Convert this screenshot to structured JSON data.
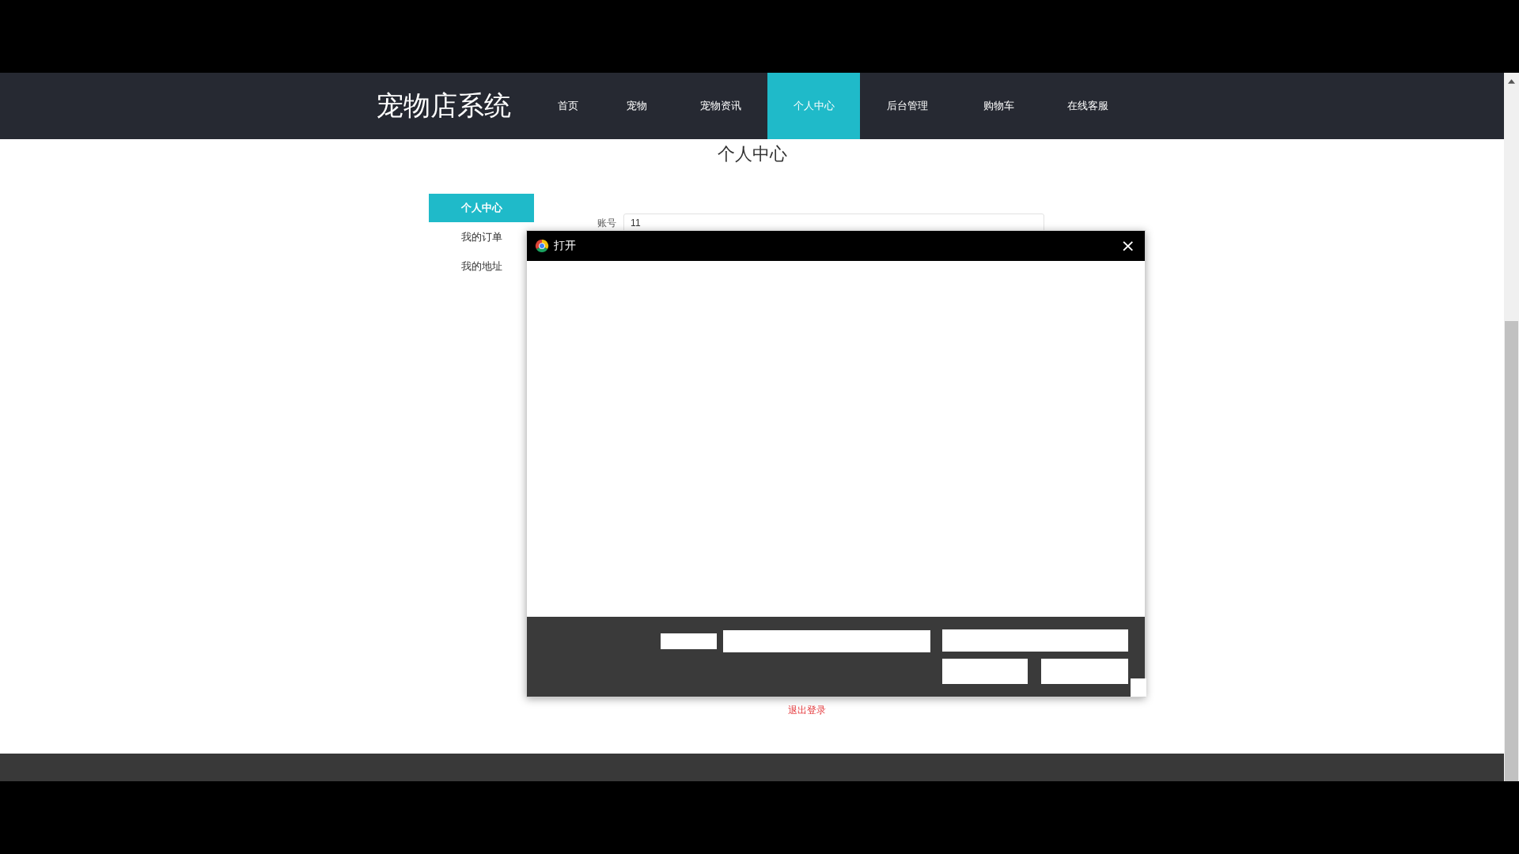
{
  "nav": {
    "logo": "宠物店系统",
    "items": [
      {
        "label": "首页",
        "selected": false
      },
      {
        "label": "宠物",
        "selected": false
      },
      {
        "label": "宠物资讯",
        "selected": false
      },
      {
        "label": "个人中心",
        "selected": true
      },
      {
        "label": "后台管理",
        "selected": false
      },
      {
        "label": "购物车",
        "selected": false
      },
      {
        "label": "在线客服",
        "selected": false
      }
    ]
  },
  "page_title": "个人中心",
  "sidebar": {
    "items": [
      {
        "label": "个人中心",
        "selected": true
      },
      {
        "label": "我的订单",
        "selected": false
      },
      {
        "label": "我的地址",
        "selected": false
      }
    ]
  },
  "form": {
    "fields": [
      {
        "label": "账号",
        "value": "11"
      }
    ]
  },
  "logout": "退出登录",
  "dialog": {
    "title": "打开",
    "close": "×"
  }
}
